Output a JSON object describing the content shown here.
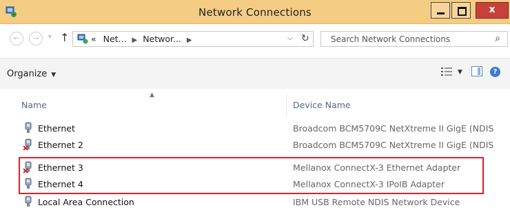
{
  "window": {
    "title": "Network Connections",
    "controls": {
      "close": "x"
    }
  },
  "nav": {
    "address_parts": [
      "«",
      "Net...",
      "Networ..."
    ],
    "search_placeholder": "Search Network Connections"
  },
  "toolbar": {
    "organize_label": "Organize"
  },
  "columns": {
    "name": "Name",
    "device": "Device Name"
  },
  "rows": [
    {
      "name": "Ethernet",
      "device": "Broadcom BCM5709C NetXtreme II GigE (NDIS",
      "disabled": false
    },
    {
      "name": "Ethernet 2",
      "device": "Broadcom BCM5709C NetXtreme II GigE (NDIS",
      "disabled": true
    },
    {
      "name": "Ethernet 3",
      "device": "Mellanox ConnectX-3 Ethernet Adapter",
      "disabled": true
    },
    {
      "name": "Ethernet 4",
      "device": "Mellanox ConnectX-3 IPoIB Adapter",
      "disabled": false
    },
    {
      "name": "Local Area Connection",
      "device": "IBM USB Remote NDIS Network Device",
      "disabled": false
    }
  ],
  "colors": {
    "titlebar": "#f5cc84",
    "close_button": "#c7413a",
    "highlight_border": "#e21e2a",
    "header_text": "#4f6b8a"
  },
  "icons": {
    "app": "network-connections-icon",
    "back": "back-arrow-icon",
    "forward": "forward-arrow-icon",
    "up": "up-arrow-icon",
    "refresh": "refresh-icon",
    "search": "search-icon",
    "view": "change-view-icon",
    "preview_pane": "preview-pane-icon",
    "help": "help-icon",
    "adapter": "network-adapter-icon",
    "disabled_mark": "red-x-icon"
  }
}
